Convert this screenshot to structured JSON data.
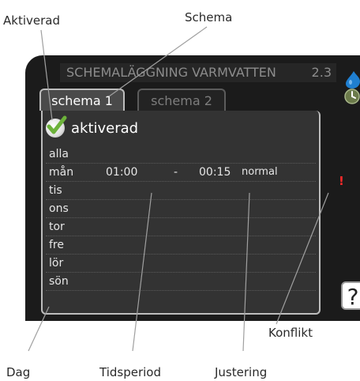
{
  "callouts": {
    "aktiverad": "Aktiverad",
    "schema": "Schema",
    "konflikt": "Konflikt",
    "dag": "Dag",
    "tidsperiod": "Tidsperiod",
    "justering": "Justering"
  },
  "screen": {
    "title": "SCHEMALÄGGNING VARMVATTEN",
    "menu_number": "2.3",
    "tabs": [
      {
        "label": "schema 1",
        "active": true
      },
      {
        "label": "schema 2",
        "active": false
      }
    ],
    "activated_label": "aktiverad",
    "activated_checked": true,
    "days": [
      {
        "day": "alla",
        "start": "",
        "dash": "",
        "end": "",
        "mode": ""
      },
      {
        "day": "mån",
        "start": "01:00",
        "dash": "-",
        "end": "00:15",
        "mode": "normal"
      },
      {
        "day": "tis",
        "start": "",
        "dash": "",
        "end": "",
        "mode": ""
      },
      {
        "day": "ons",
        "start": "",
        "dash": "",
        "end": "",
        "mode": ""
      },
      {
        "day": "tor",
        "start": "",
        "dash": "",
        "end": "",
        "mode": ""
      },
      {
        "day": "fre",
        "start": "",
        "dash": "",
        "end": "",
        "mode": ""
      },
      {
        "day": "lör",
        "start": "",
        "dash": "",
        "end": "",
        "mode": ""
      },
      {
        "day": "sön",
        "start": "",
        "dash": "",
        "end": "",
        "mode": ""
      }
    ],
    "conflict_mark": "!",
    "help_glyph": "?"
  },
  "icons": {
    "check": "checkmark-icon",
    "drop": "water-drop-icon",
    "clock": "clock-icon",
    "help": "help-icon"
  },
  "colors": {
    "screen_bg": "#1b1b1b",
    "panel_bg": "#333333",
    "check_green": "#6cb23a",
    "conflict_red": "#ff2a2a",
    "drop_blue": "#1f7fd0"
  }
}
